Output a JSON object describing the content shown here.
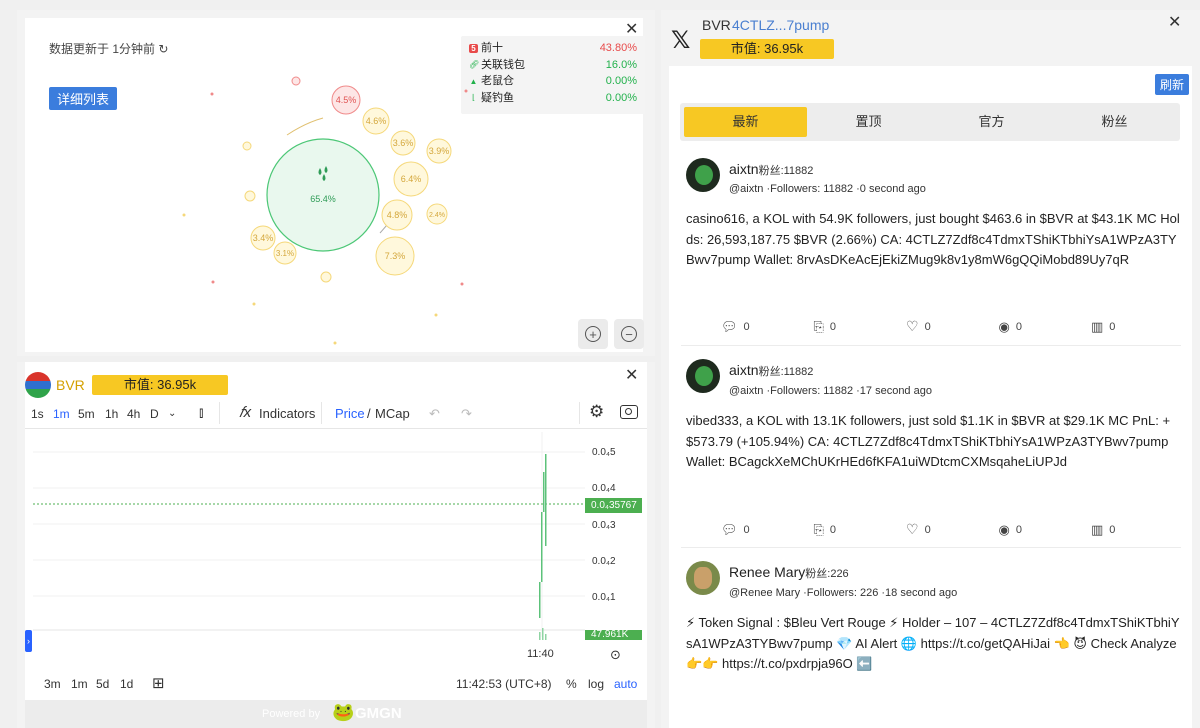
{
  "bubble": {
    "update_text": "数据更新于 1分钟前",
    "detail_button": "详细列表",
    "legend": [
      {
        "label": "前十",
        "value": "43.80%",
        "color": "#e84a4a",
        "icon": "top-ten-icon"
      },
      {
        "label": "关联钱包",
        "value": "16.0%",
        "color": "#22b14c",
        "icon": "link-icon"
      },
      {
        "label": "老鼠仓",
        "value": "0.00%",
        "color": "#22b14c",
        "icon": "rat-icon"
      },
      {
        "label": "疑钓鱼",
        "value": "0.00%",
        "color": "#22b14c",
        "icon": "fishing-icon"
      }
    ],
    "bubbles": [
      "65.4%",
      "4.5%",
      "4.6%",
      "3.6%",
      "3.9%",
      "6.4%",
      "4.8%",
      "2.4%",
      "3.4%",
      "3.1%",
      "7.3%"
    ]
  },
  "chart": {
    "token": "BVR",
    "mc_label": "市值: 36.95k",
    "timeframes": [
      "1s",
      "1m",
      "5m",
      "1h",
      "4h",
      "D"
    ],
    "active_timeframe": "1m",
    "indicators_label": "Indicators",
    "price_label": "Price",
    "mcap_label": "MCap",
    "price_ticks": [
      "0.0₄5",
      "0.0₄4",
      "0.0₄3",
      "0.0₄2",
      "0.0₄1"
    ],
    "current_price": "0.0₄35767",
    "volume_value": "47.961K",
    "time_tick": "11:40",
    "ranges": [
      "3m",
      "1m",
      "5d",
      "1d"
    ],
    "clock": "11:42:53 (UTC+8)",
    "pct": "%",
    "log": "log",
    "auto": "auto",
    "powered": "Powered by",
    "brand": "GMGN",
    "up_color": "#5cc27a",
    "price_line_color": "#4caf50"
  },
  "twitter": {
    "title_token": "BVR",
    "title_ca": "4CTLZ...7pump",
    "mc_label": "市值: 36.95k",
    "refresh": "刷新",
    "tabs": [
      "最新",
      "置顶",
      "官方",
      "粉丝"
    ],
    "posts": [
      {
        "name": "aixtn",
        "fans": "粉丝:11882",
        "handle": "@aixtn ·Followers: 11882 ·0 second ago",
        "text": "casino616, a KOL with 54.9K followers, just bought $463.6 in $BVR at $43.1K MC Holds: 26,593,187.75 $BVR (2.66%) CA: 4CTLZ7Zdf8c4TdmxTShiKTbhiYsA1WPzA3TYBwv7pump Wallet: 8rvAsDKeAcEjEkiZMug9k8v1y8mW6gQQiMobd89Uy7qR",
        "actions": [
          "0",
          "0",
          "0",
          "0",
          "0"
        ]
      },
      {
        "name": "aixtn",
        "fans": "粉丝:11882",
        "handle": "@aixtn ·Followers: 11882 ·17 second ago",
        "text": "vibed333, a KOL with 13.1K followers, just sold $1.1K in $BVR at $29.1K MC PnL: +$573.79 (+105.94%) CA: 4CTLZ7Zdf8c4TdmxTShiKTbhiYsA1WPzA3TYBwv7pump Wallet: BCagckXeMChUKrHEd6fKFA1uiWDtcmCXMsqaheLiUPJd",
        "actions": [
          "0",
          "0",
          "0",
          "0",
          "0"
        ]
      },
      {
        "name": "Renee Mary",
        "fans": "粉丝:226",
        "handle": "@Renee Mary ·Followers: 226 ·18 second ago",
        "text": "⚡ Token Signal : $Bleu Vert Rouge ⚡   Holder – 107   – 4CTLZ7Zdf8c4TdmxTShiKTbhiYsA1WPzA3TYBwv7pump 💎 AI Alert 🌐 https://t.co/getQAHiJai 👈 😈 Check Analyze 👉👉 https://t.co/pxdrpja96O ⬅️"
      }
    ]
  }
}
